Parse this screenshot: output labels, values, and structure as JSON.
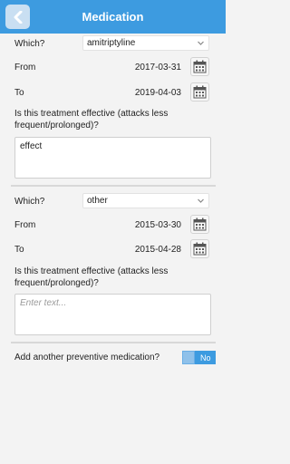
{
  "header": {
    "title": "Medication",
    "back_icon": "chevron-left-icon"
  },
  "medications": [
    {
      "which_label": "Which?",
      "which_value": "amitriptyline",
      "from_label": "From",
      "from_value": "2017-03-31",
      "to_label": "To",
      "to_value": "2019-04-03",
      "question": "Is this treatment effective (attacks less frequent/prolonged)?",
      "answer_value": "effect",
      "answer_placeholder": ""
    },
    {
      "which_label": "Which?",
      "which_value": "other",
      "from_label": "From",
      "from_value": "2015-03-30",
      "to_label": "To",
      "to_value": "2015-04-28",
      "question": "Is this treatment effective (attacks less frequent/prolonged)?",
      "answer_value": "",
      "answer_placeholder": "Enter text..."
    }
  ],
  "add_another": {
    "label": "Add another preventive medication?",
    "toggle_value": "No"
  },
  "colors": {
    "accent": "#3d9be0",
    "background": "#f3f3f3"
  }
}
